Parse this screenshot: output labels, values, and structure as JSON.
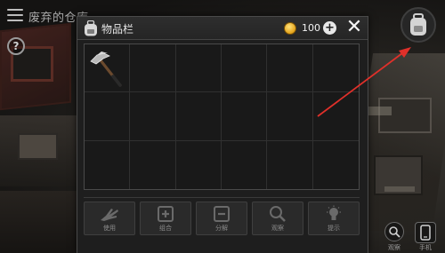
{
  "hud": {
    "location_title": "废弃的仓库",
    "help_label": "?",
    "zoom_label": "观察",
    "phone_label": "手机"
  },
  "inventory": {
    "title": "物品栏",
    "coins": "100",
    "add_coin_label": "+",
    "close_label": "✕",
    "items": [
      {
        "name": "hammer",
        "icon": "hammer-icon"
      }
    ],
    "slot_count": 18,
    "actions": [
      {
        "label": "使用",
        "icon": "use-hand-icon"
      },
      {
        "label": "组合",
        "icon": "combine-icon"
      },
      {
        "label": "分解",
        "icon": "split-icon"
      },
      {
        "label": "观察",
        "icon": "magnifier-icon"
      },
      {
        "label": "提示",
        "icon": "lightbulb-icon"
      }
    ]
  },
  "colors": {
    "annotation_arrow": "#e0302a",
    "coin": "#e3a21a",
    "panel_bg": "#1e1e1e"
  }
}
